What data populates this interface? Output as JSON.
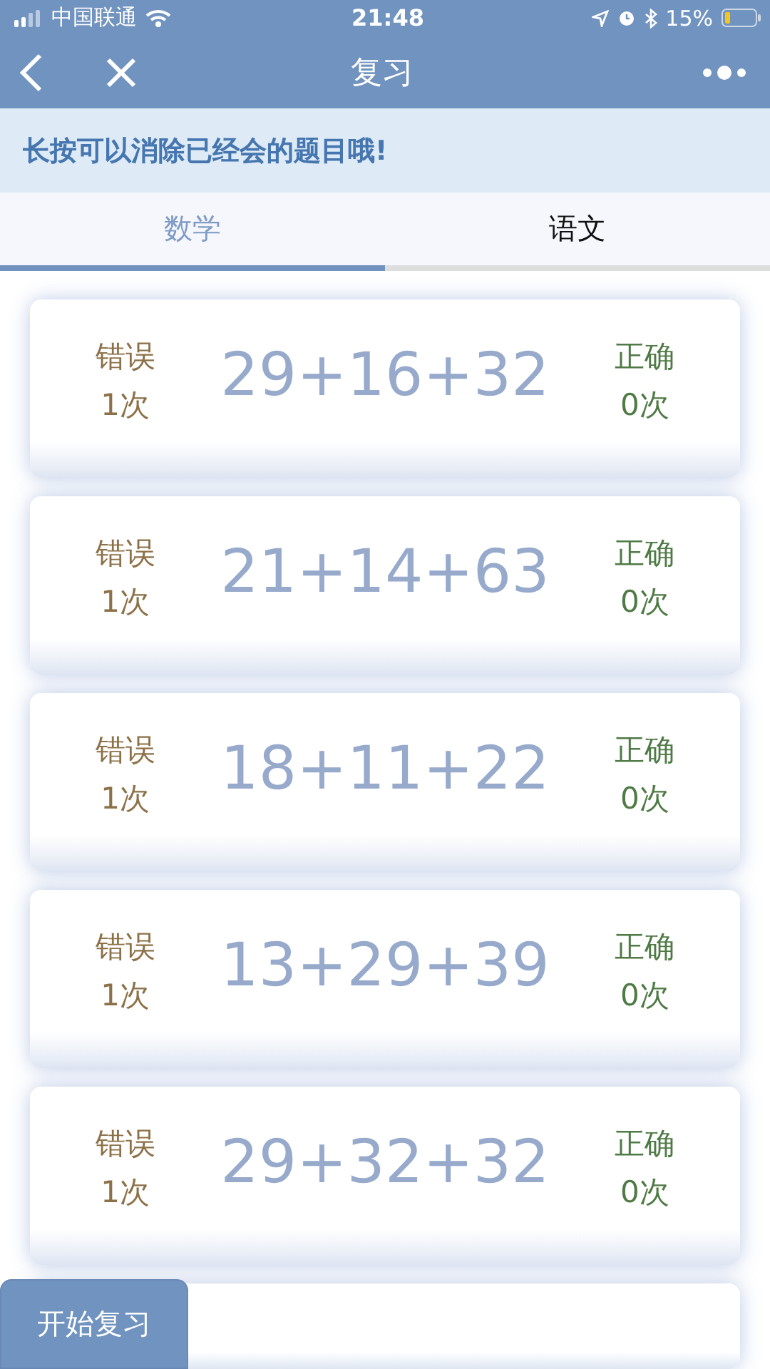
{
  "status_bar": {
    "carrier": "中国联通",
    "time": "21:48",
    "battery_text": "15%"
  },
  "nav": {
    "title": "复习"
  },
  "notice": "长按可以消除已经会的题目哦!",
  "tabs": [
    {
      "label": "数学",
      "selected": true
    },
    {
      "label": "语文",
      "selected": false
    }
  ],
  "cards": [
    {
      "kind": "full",
      "wrong_label": "错误",
      "wrong_count": "1次",
      "equation": "29+16+32",
      "right_label": "正确",
      "right_count": "0次"
    },
    {
      "kind": "full",
      "wrong_label": "错误",
      "wrong_count": "1次",
      "equation": "21+14+63",
      "right_label": "正确",
      "right_count": "0次"
    },
    {
      "kind": "full",
      "wrong_label": "错误",
      "wrong_count": "1次",
      "equation": "18+11+22",
      "right_label": "正确",
      "right_count": "0次"
    },
    {
      "kind": "full",
      "wrong_label": "错误",
      "wrong_count": "1次",
      "equation": "13+29+39",
      "right_label": "正确",
      "right_count": "0次"
    },
    {
      "kind": "full",
      "wrong_label": "错误",
      "wrong_count": "1次",
      "equation": "29+32+32",
      "right_label": "正确",
      "right_count": "0次"
    },
    {
      "kind": "cut"
    }
  ],
  "start_button": {
    "label": "开始复习"
  }
}
